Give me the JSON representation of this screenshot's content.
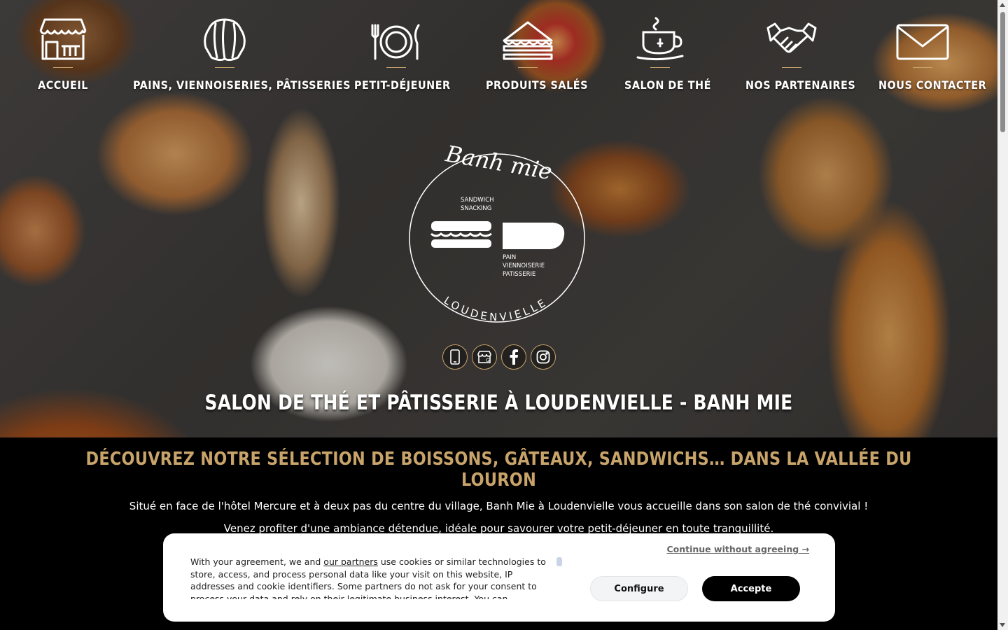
{
  "nav": {
    "items": [
      {
        "label": "ACCUEIL",
        "icon": "shop-icon"
      },
      {
        "label": "PAINS, VIENNOISERIES, PÂTISSERIES",
        "icon": "croissant-icon"
      },
      {
        "label": "PETIT-DÉJEUNER",
        "icon": "plate-cutlery-icon"
      },
      {
        "label": "PRODUITS SALÉS",
        "icon": "sandwich-icon"
      },
      {
        "label": "SALON DE THÉ",
        "icon": "teacup-icon"
      },
      {
        "label": "NOS PARTENAIRES",
        "icon": "handshake-icon"
      },
      {
        "label": "NOUS CONTACTER",
        "icon": "envelope-icon"
      }
    ]
  },
  "logo": {
    "script": "Banh mie",
    "line1": "SANDWICH",
    "line2": "SNACKING",
    "line3": "PAIN",
    "line4": "VIENNOISERIE",
    "line5": "PATISSERIE",
    "town": "LOUDENVIELLE"
  },
  "socials": [
    "phone-icon",
    "google-business-icon",
    "facebook-icon",
    "instagram-icon"
  ],
  "hero": {
    "title": "SALON DE THÉ ET PÂTISSERIE À LOUDENVIELLE - BANH MIE"
  },
  "content": {
    "section_title": "DÉCOUVREZ NOTRE SÉLECTION DE BOISSONS, GÂTEAUX, SANDWICHS… DANS LA VALLÉE DU LOURON",
    "para1": "Situé en face de l'hôtel Mercure et à deux pas du centre du village, Banh Mie à Loudenvielle vous accueille dans son salon de thé convivial !",
    "para2_before": "Venez profiter d'une ambiance détendue, idéale pour savourer votre ",
    "para2_link": "petit-déjeuner",
    "para2_after": " en toute tranquillité."
  },
  "cookie": {
    "text_before": "With your agreement, we and ",
    "link": "our partners",
    "text_after": " use cookies or similar technologies to store, access, and process personal data like your visit on this website, IP addresses and cookie identifiers. Some partners do not ask for your consent to process your data and rely on their legitimate business interest. You can",
    "continue": "Continue without agreeing →",
    "configure": "Configure",
    "accept": "Accepte"
  },
  "colors": {
    "accent": "#c8a46a",
    "background": "#000000",
    "white": "#ffffff"
  }
}
